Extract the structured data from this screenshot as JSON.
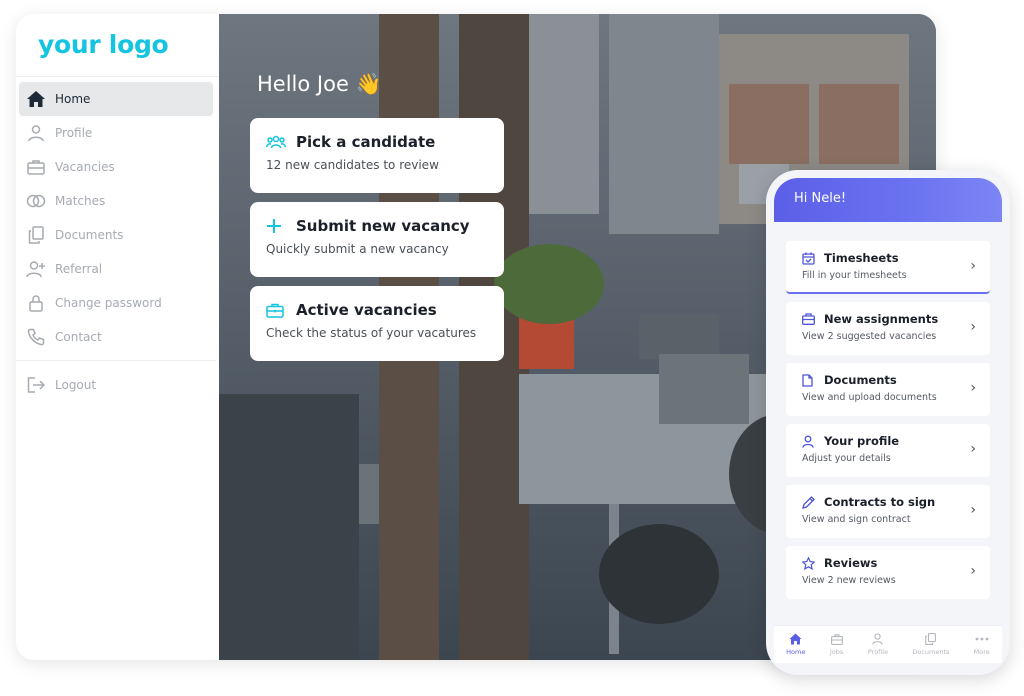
{
  "logo": "your logo",
  "sidebar": {
    "items": [
      {
        "label": "Home",
        "icon": "home-icon",
        "active": true
      },
      {
        "label": "Profile",
        "icon": "user-icon"
      },
      {
        "label": "Vacancies",
        "icon": "briefcase-icon"
      },
      {
        "label": "Matches",
        "icon": "link-icon"
      },
      {
        "label": "Documents",
        "icon": "documents-icon"
      },
      {
        "label": "Referral",
        "icon": "add-user-icon"
      },
      {
        "label": "Change password",
        "icon": "lock-icon"
      },
      {
        "label": "Contact",
        "icon": "phone-icon"
      }
    ],
    "logout": {
      "label": "Logout",
      "icon": "logout-icon"
    }
  },
  "main": {
    "greeting": "Hello Joe 👋",
    "cards": [
      {
        "title": "Pick a candidate",
        "subtitle": "12 new candidates to review",
        "icon": "people-icon"
      },
      {
        "title": "Submit new vacancy",
        "subtitle": "Quickly submit a new vacancy",
        "icon": "plus-icon"
      },
      {
        "title": "Active vacancies",
        "subtitle": "Check the status of your vacatures",
        "icon": "briefcase-icon"
      }
    ]
  },
  "mobile": {
    "greeting": "Hi Nele!",
    "items": [
      {
        "title": "Timesheets",
        "subtitle": "Fill in your timesheets",
        "icon": "calendar-icon"
      },
      {
        "title": "New assignments",
        "subtitle": "View 2 suggested vacancies",
        "icon": "briefcase-icon"
      },
      {
        "title": "Documents",
        "subtitle": "View and upload documents",
        "icon": "document-icon"
      },
      {
        "title": "Your profile",
        "subtitle": "Adjust your details",
        "icon": "user-icon"
      },
      {
        "title": "Contracts to sign",
        "subtitle": "View and sign contract",
        "icon": "pen-icon"
      },
      {
        "title": "Reviews",
        "subtitle": "View 2 new reviews",
        "icon": "star-icon"
      }
    ],
    "tabs": [
      {
        "label": "Home",
        "icon": "home-icon",
        "active": true
      },
      {
        "label": "Jobs",
        "icon": "briefcase-icon"
      },
      {
        "label": "Profile",
        "icon": "user-icon"
      },
      {
        "label": "Documents",
        "icon": "documents-icon"
      },
      {
        "label": "More",
        "icon": "more-icon"
      }
    ]
  },
  "colors": {
    "brand": "#14c4e0",
    "mobile_accent": "#5b5fe8",
    "card_icon": "#14c4e0"
  }
}
